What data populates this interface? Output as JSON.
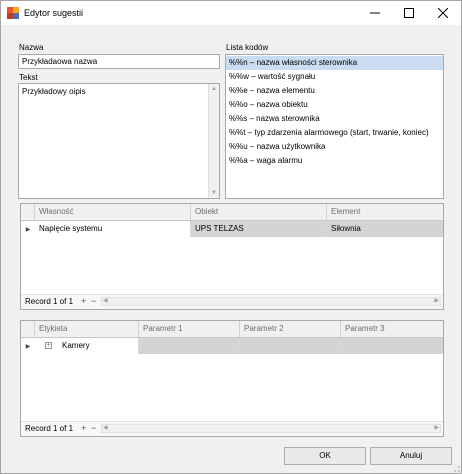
{
  "window": {
    "title": "Edytor sugestii"
  },
  "form": {
    "name_label": "Nazwa",
    "name_value": "Przykładaowa nazwa",
    "text_label": "Tekst",
    "text_value": "Przykładowy oipis",
    "codes_label": "Lista kodów",
    "codes": [
      "%%n – nazwa własności sterownika",
      "%%w – wartość sygnału",
      "%%e  – nazwa elementu",
      "%%o – nazwa obiektu",
      "%%s  – nazwa sterownika",
      "%%t  – typ zdarzenia alarmowego (start, trwanie, koniec)",
      "%%u  – nazwa użytkownika",
      "%%a  – waga alarmu"
    ]
  },
  "grid1": {
    "columns": [
      "Własność",
      "Obiekt",
      "Element"
    ],
    "rows": [
      [
        "Napięcie systemu",
        "UPS TELZAS",
        "Siłownia"
      ]
    ],
    "record_text": "Record 1 of 1"
  },
  "grid2": {
    "columns": [
      "Etykieta",
      "Parametr 1",
      "Parametr 2",
      "Parametr 3"
    ],
    "rows": [
      [
        "Kamery",
        "",
        "",
        ""
      ]
    ],
    "record_text": "Record 1 of 1"
  },
  "buttons": {
    "ok": "OK",
    "cancel": "Anuluj"
  },
  "icons": {
    "app": "app-logo-icon",
    "minimize": "minimize-icon",
    "maximize": "maximize-icon",
    "close": "close-icon"
  }
}
